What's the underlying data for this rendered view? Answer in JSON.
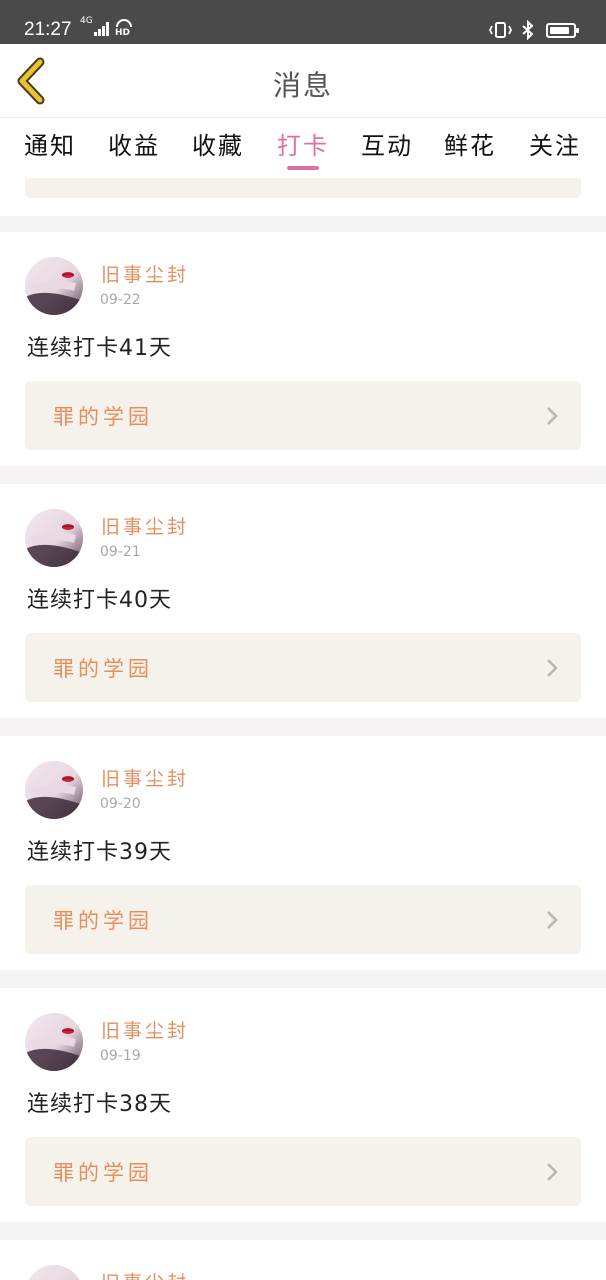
{
  "status_bar": {
    "time": "21:27",
    "network": "4G",
    "battery_level": 0.85,
    "text_color": "#ffffff",
    "background": "#4a4a4a"
  },
  "header": {
    "back_icon": "chevron-left-icon",
    "title": "消息"
  },
  "tabs": [
    {
      "label": "通知",
      "active": false
    },
    {
      "label": "收益",
      "active": false
    },
    {
      "label": "收藏",
      "active": false
    },
    {
      "label": "打卡",
      "active": true
    },
    {
      "label": "互动",
      "active": false
    },
    {
      "label": "鲜花",
      "active": false
    },
    {
      "label": "关注",
      "active": false
    }
  ],
  "colors": {
    "accent": "#e06fa1",
    "username": "#e58f5f",
    "link_bg": "#f4f2ea",
    "back_icon": "#e8c33a"
  },
  "feed": [
    {
      "username": "旧事尘封",
      "date": "09-22",
      "content": "连续打卡41天",
      "link_label": "罪的学园"
    },
    {
      "username": "旧事尘封",
      "date": "09-21",
      "content": "连续打卡40天",
      "link_label": "罪的学园"
    },
    {
      "username": "旧事尘封",
      "date": "09-20",
      "content": "连续打卡39天",
      "link_label": "罪的学园"
    },
    {
      "username": "旧事尘封",
      "date": "09-19",
      "content": "连续打卡38天",
      "link_label": "罪的学园"
    },
    {
      "username": "旧事尘封"
    }
  ]
}
